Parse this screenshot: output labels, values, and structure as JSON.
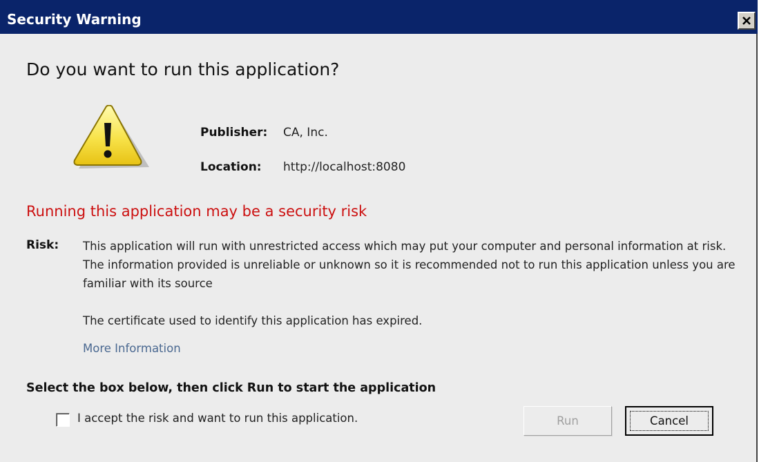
{
  "window": {
    "title": "Security Warning",
    "close_icon": "close-icon",
    "colors": {
      "titlebar": "#0a246a",
      "body": "#ececec",
      "risk_heading": "#cc1010",
      "link": "#4a6890"
    }
  },
  "dialog": {
    "heading": "Do you want to run this application?",
    "warning_icon": "warning-triangle-icon",
    "publisher_label": "Publisher:",
    "publisher_value": "CA, Inc.",
    "location_label": "Location:",
    "location_value": "http://localhost:8080",
    "risk_heading": "Running this application may be a security risk",
    "risk_label": "Risk:",
    "risk_text": "This application will run with unrestricted access which may put your computer and personal information at risk. The information provided is unreliable or unknown so it is recommended not to run this application unless you are familiar with its source",
    "certificate_text": "The certificate used to identify this application has expired.",
    "more_info_link": "More Information",
    "instruction": "Select the box below, then click Run to start the application",
    "accept_checkbox_label": "I accept the risk and want to run this application.",
    "accept_checked": false,
    "run_button": "Run",
    "run_enabled": false,
    "cancel_button": "Cancel"
  }
}
